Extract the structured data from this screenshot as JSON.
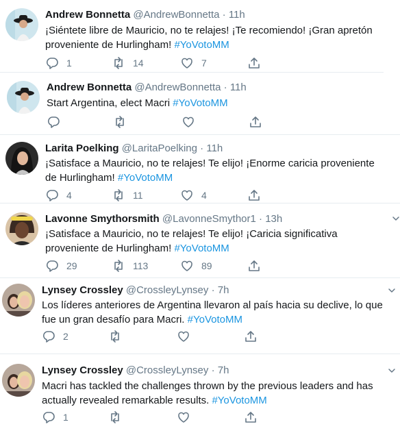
{
  "tweets": [
    {
      "name": "Andrew Bonnetta",
      "handle": "@AndrewBonnetta",
      "dot": "·",
      "time": "11h",
      "text": "¡Siéntete libre de Mauricio, no te relajes! ¡Te recomiendo! ¡Gran apretón proveniente de Hurlingham! ",
      "hashtag": "#YoVotoMM",
      "replies": "1",
      "retweets": "14",
      "likes": "7"
    },
    {
      "name": "Andrew Bonnetta",
      "handle": "@AndrewBonnetta",
      "dot": "·",
      "time": "11h",
      "text": "Start Argentina, elect Macri ",
      "hashtag": "#YoVotoMM",
      "replies": "",
      "retweets": "",
      "likes": ""
    },
    {
      "name": "Larita Poelking",
      "handle": "@LaritaPoelking",
      "dot": "·",
      "time": "11h",
      "text": "¡Satisface a Mauricio, no te relajes! Te elijo! ¡Enorme caricia proveniente de Hurlingham! ",
      "hashtag": "#YoVotoMM",
      "replies": "4",
      "retweets": "11",
      "likes": "4"
    },
    {
      "name": "Lavonne Smythorsmith",
      "handle": "@LavonneSmythor1",
      "dot": "·",
      "time": "13h",
      "text": "¡Satisface a Mauricio, no te relajes! Te elijo! ¡Caricia significativa proveniente de Hurlingham! ",
      "hashtag": "#YoVotoMM",
      "replies": "29",
      "retweets": "113",
      "likes": "89"
    },
    {
      "name": "Lynsey Crossley",
      "handle": "@CrossleyLynsey",
      "dot": "·",
      "time": "7h",
      "text": "Los líderes anteriores de Argentina llevaron al país hacia su declive, lo que fue un gran desafío para Macri. ",
      "hashtag": "#YoVotoMM",
      "replies": "2",
      "retweets": "",
      "likes": ""
    },
    {
      "name": "Lynsey Crossley",
      "handle": "@CrossleyLynsey",
      "dot": "·",
      "time": "7h",
      "text": "Macri has tackled the challenges thrown by the previous leaders and has actually revealed remarkable results. ",
      "hashtag": "#YoVotoMM",
      "replies": "1",
      "retweets": "",
      "likes": ""
    }
  ],
  "colors": {
    "text": "#14171a",
    "muted": "#657786",
    "link": "#1b95e0",
    "separator": "#e6ecf0"
  },
  "icons": [
    "reply-icon",
    "retweet-icon",
    "like-icon",
    "share-icon",
    "chevron-down-icon"
  ]
}
